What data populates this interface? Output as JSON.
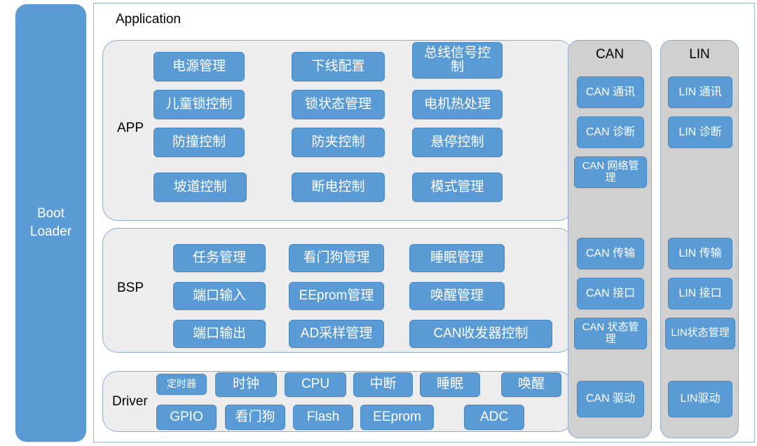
{
  "bootloader": {
    "label": "Boot\nLoader"
  },
  "frame": {
    "title": "Application"
  },
  "layers": [
    {
      "id": "app",
      "label": "APP"
    },
    {
      "id": "bsp",
      "label": "BSP"
    },
    {
      "id": "driver",
      "label": "Driver"
    }
  ],
  "app_modules": {
    "col1": [
      "电源管理",
      "儿童锁控制",
      "防撞控制",
      "坡道控制"
    ],
    "col2": [
      "下线配置",
      "锁状态管理",
      "防夹控制",
      "断电控制"
    ],
    "col3": [
      "总线信号控制",
      "电机热处理",
      "悬停控制",
      "模式管理"
    ]
  },
  "bsp_modules": {
    "col1": [
      "任务管理",
      "端口输入",
      "端口输出"
    ],
    "col2": [
      "看门狗管理",
      "EEprom管理",
      "AD采样管理"
    ],
    "col3": [
      "睡眠管理",
      "唤醒管理",
      "CAN收发器控制"
    ]
  },
  "driver_modules": {
    "row1": [
      "定时器",
      "时钟",
      "CPU",
      "中断",
      "睡眠",
      "唤醒"
    ],
    "row2": [
      "GPIO",
      "看门狗",
      "Flash",
      "EEprom",
      "ADC"
    ]
  },
  "can_stack": {
    "title": "CAN",
    "items": [
      "CAN 通讯",
      "CAN 诊断",
      "CAN 网络管理",
      "CAN 传输",
      "CAN 接口",
      "CAN 状态管理",
      "CAN 驱动"
    ]
  },
  "lin_stack": {
    "title": "LIN",
    "items": [
      "LIN 通讯",
      "LIN 诊断",
      "LIN 传输",
      "LIN 接口",
      "LIN状态管理",
      "LIN驱动"
    ]
  },
  "colors": {
    "module_blue": "#5B9BD5",
    "layer_gray": "#EDEDED",
    "stack_gray": "#D0D0D0",
    "frame_border": "#9DB8D6",
    "text_white": "#FFFFFF",
    "text_black": "#000000"
  }
}
